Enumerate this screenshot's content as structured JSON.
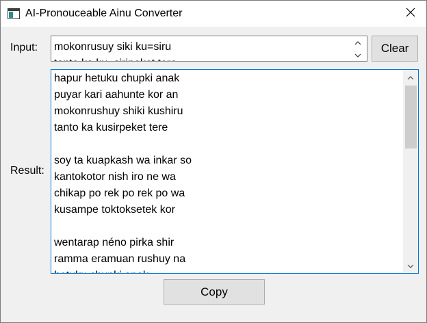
{
  "window": {
    "title": "AI-Pronouceable Ainu Converter",
    "icons": {
      "app": "app-window-icon",
      "close": "close-icon"
    }
  },
  "input": {
    "label": "Input:",
    "lines": [
      "mokonrusuy siki ku=siru",
      "tanto ka ku=siripeket tere"
    ],
    "icons": {
      "up": "spin-up-icon",
      "down": "spin-down-icon"
    }
  },
  "clear_button": {
    "label": "Clear"
  },
  "result": {
    "label": "Result:",
    "lines": [
      "hapur hetuku chupki anak",
      "puyar kari aahunte kor an",
      "mokonrushuy shiki kushiru",
      "tanto ka kusirpeket tere",
      "",
      "soy ta kuapkash wa inkar so",
      "kantokotor nish iro ne wa",
      "chikap po rek po rek po wa",
      "kusampe toktoksetek kor",
      "",
      "wentarap néno pirka shir",
      "ramma eramuan rushuy na",
      "hetuku chupki anak"
    ],
    "icons": {
      "up": "scroll-up-icon",
      "down": "scroll-down-icon"
    }
  },
  "copy_button": {
    "label": "Copy"
  }
}
